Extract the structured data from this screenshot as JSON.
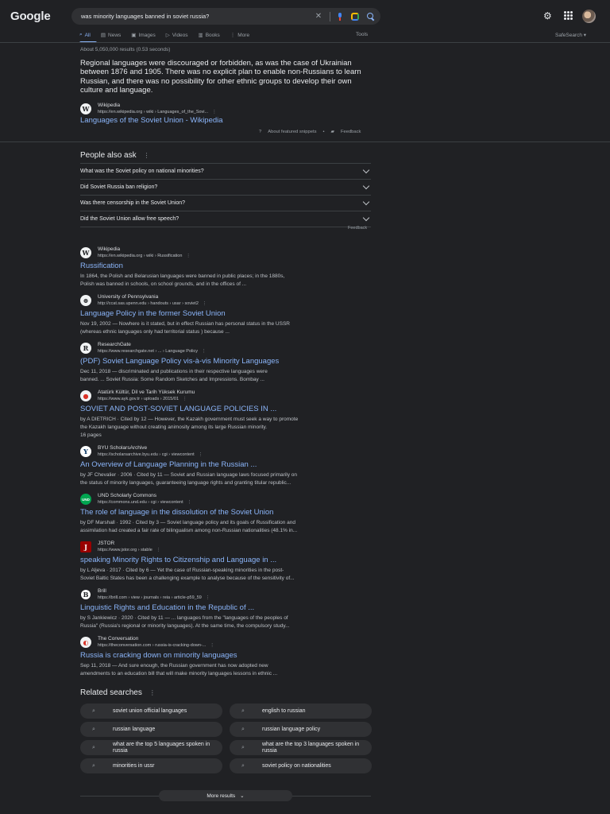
{
  "header": {
    "logo": "Google",
    "query": "was minority languages banned in soviet russia?"
  },
  "tabs": [
    {
      "label": "All",
      "icon": "search-icon"
    },
    {
      "label": "News",
      "icon": "news-icon"
    },
    {
      "label": "Images",
      "icon": "image-icon"
    },
    {
      "label": "Videos",
      "icon": "video-icon"
    },
    {
      "label": "Books",
      "icon": "book-icon"
    },
    {
      "label": "More",
      "icon": "more-dots-icon"
    }
  ],
  "tools_label": "Tools",
  "safesearch_label": "SafeSearch",
  "stats": "About 5,050,000 results (0.53 seconds)",
  "featured": {
    "text": "Regional languages were discouraged or forbidden, as was the case of Ukrainian between 1876 and 1905. There was no explicit plan to enable non-Russians to learn Russian, and there was no possibility for other ethnic groups to develop their own culture and language.",
    "site": "Wikipedia",
    "url": "https://en.wikipedia.org › wiki › Languages_of_the_Sovi...",
    "title": "Languages of the Soviet Union - Wikipedia",
    "about": "About featured snippets",
    "sep": "•",
    "feedback": "Feedback"
  },
  "paa": {
    "heading": "People also ask",
    "questions": [
      "What was the Soviet policy on national minorities?",
      "Did Soviet Russia ban religion?",
      "Was there censorship in the Soviet Union?",
      "Did the Soviet Union allow free speech?"
    ],
    "feedback": "Feedback"
  },
  "results": [
    {
      "site": "Wikipedia",
      "favicon": "W",
      "url": "https://en.wikipedia.org › wiki › Russification",
      "title": "Russification",
      "line1": "In 1864, the Polish and Belarusian languages were banned in public places; in the 1880s,",
      "line2": "Polish was banned in schools, on school grounds, and in the offices of ..."
    },
    {
      "site": "University of Pennsylvania",
      "favicon": "⊛",
      "url": "http://ccat.sas.upenn.edu › handouts › usar › soviet2",
      "title": "Language Policy in the former Soviet Union",
      "line1": "Nov 19, 2002 — Nowhere is it stated, but in effect Russian has personal status in the USSR",
      "line2": "(whereas ethnic languages only had territorial status ) because ..."
    },
    {
      "site": "ResearchGate",
      "favicon": "R",
      "url": "https://www.researchgate.net › ... › Language Policy",
      "title": "(PDF) Soviet Language Policy vis-à-vis Minority Languages",
      "line1": "Dec 11, 2018 — discriminated and publications in their respective languages were",
      "line2": "banned. ... Soviet Russia: Some Random Sketches and Impressions. Bombay ..."
    },
    {
      "site": "Atatürk Kültür, Dil ve Tarih Yüksek Kurumu",
      "favicon": "●",
      "url": "https://www.ayk.gov.tr › uploads › 2015/01",
      "title": "SOVIET AND POST-SOVIET LANGUAGE POLICIES IN ...",
      "line1": "by A DIETRICH · Cited by 12 — However, the Kazakh government must seek a way to promote",
      "line2": "the Kazakh language without creating animosity among its large Russian minority.",
      "line3": "16 pages"
    },
    {
      "site": "BYU ScholarsArchive",
      "favicon": "Y",
      "url": "https://scholarsarchive.byu.edu › cgi › viewcontent",
      "title": "An Overview of Language Planning in the Russian ...",
      "line1": "by JF Chevalier · 2006 · Cited by 11 — Soviet and Russian language laws focused primarily on",
      "line2": "the status of minority languages, guaranteeing language rights and granting titular republic..."
    },
    {
      "site": "UND Scholarly Commons",
      "favicon": "UND",
      "url": "https://commons.und.edu › cgi › viewcontent",
      "title": "The role of language in the dissolution of the Soviet Union",
      "line1": "by DF Marshall · 1992 · Cited by 3 — Soviet language policy and its goals of Russification and",
      "line2": "assimilation had created a fair rate of bilingualism among non-Russian nationalities (48.1% in..."
    },
    {
      "site": "JSTOR",
      "favicon": "J",
      "url": "https://www.jstor.org › stable",
      "title": "speaking Minority Rights to Citizenship and Language in ...",
      "line1": "by L Aljeva · 2017 · Cited by 6 — Yet the case of Russian-speaking minorities in the post-",
      "line2": "Soviet Baltic States has been a challenging example to analyse because of the sensitivity of..."
    },
    {
      "site": "Brill",
      "favicon": "B",
      "url": "https://brill.com › view › journals › reia › article-p59_59",
      "title": "Linguistic Rights and Education in the Republic of ...",
      "line1": "by S Jankiewicz · 2020 · Cited by 11 — ... languages from the \"languages of the peoples of",
      "line2": "Russia\" (Russia's regional or minority languages). At the same time, the compulsory study..."
    },
    {
      "site": "The Conversation",
      "favicon": "◐",
      "url": "https://theconversation.com › russia-is-cracking-down-...",
      "title": "Russia is cracking down on minority languages",
      "line1": "Sep 11, 2018 — And sure enough, the Russian government has now adopted new",
      "line2": "amendments to an education bill that will make minority languages lessons in ethnic ..."
    }
  ],
  "related": {
    "heading": "Related searches",
    "items": [
      {
        "label": "soviet union official languages"
      },
      {
        "label": "english to russian"
      },
      {
        "label": "russian language"
      },
      {
        "label": "russian language policy"
      },
      {
        "label": "what are the top 5 languages spoken in russia"
      },
      {
        "label": "what are the top 3 languages spoken in russia"
      },
      {
        "label": "minorities in ussr"
      },
      {
        "label": "soviet policy on nationalities"
      }
    ]
  },
  "more_results": "More results",
  "colors": {
    "background": "#202124",
    "link": "#8ab4f8",
    "text": "#bdc1c6"
  }
}
